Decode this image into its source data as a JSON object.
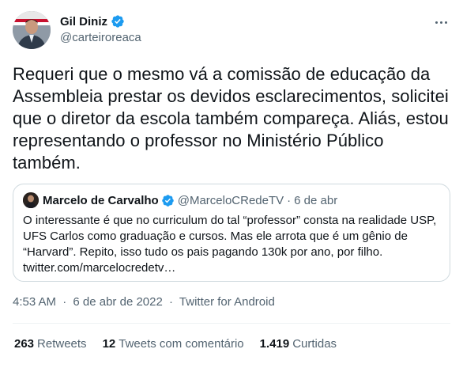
{
  "author": {
    "name": "Gil Diniz",
    "handle": "@carteiroreaca",
    "verified_icon": "verified-badge-icon",
    "accent": "#1d9bf0"
  },
  "tweet": {
    "text": "Requeri que o mesmo vá a comissão de educação da Assembleia prestar os devidos esclarecimentos, solicitei que o diretor da escola também compareça. Aliás, estou representando o professor no Ministério Público também."
  },
  "quote": {
    "name": "Marcelo de Carvalho",
    "handle": "@MarceloCRedeTV",
    "separator": "·",
    "date": "6 de abr",
    "text": "O interessante é que no curriculum do tal “professor” consta na realidade USP, UFS Carlos como graduação e cursos. Mas ele arrota que é um gênio de “Harvard”. Repito, isso tudo os pais pagando 130k por ano, por filho. twitter.com/marcelocredetv…"
  },
  "meta": {
    "time": "4:53 AM",
    "separator": "·",
    "date": "6 de abr de 2022",
    "source": "Twitter for Android"
  },
  "stats": {
    "retweets_count": "263",
    "retweets_label": "Retweets",
    "quotes_count": "12",
    "quotes_label": "Tweets com comentário",
    "likes_count": "1.419",
    "likes_label": "Curtidas"
  },
  "colors": {
    "text": "#0f1419",
    "secondary": "#536471",
    "border": "#cfd9de",
    "verified": "#1d9bf0"
  }
}
